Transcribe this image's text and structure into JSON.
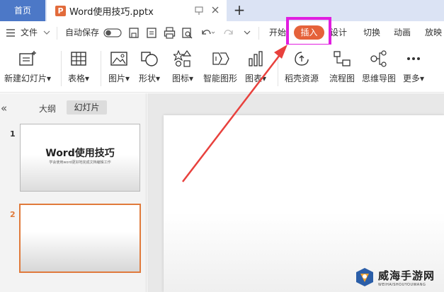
{
  "titlebar": {
    "home_tab": "首页",
    "doc_logo": "P",
    "doc_title": "Word使用技巧.pptx",
    "add_tab": "+"
  },
  "menubar": {
    "file": "文件",
    "autosave": "自动保存",
    "items": [
      "开始",
      "插入",
      "设计",
      "切换",
      "动画",
      "放映"
    ]
  },
  "ribbon": {
    "buttons": [
      {
        "label": "新建幻灯片",
        "icon": "new-slide-icon",
        "dropdown": true
      },
      {
        "label": "表格",
        "icon": "table-icon",
        "dropdown": true
      },
      {
        "label": "图片",
        "icon": "picture-icon",
        "dropdown": true
      },
      {
        "label": "形状",
        "icon": "shape-icon",
        "dropdown": true
      },
      {
        "label": "图标",
        "icon": "icons-icon",
        "dropdown": true
      },
      {
        "label": "智能图形",
        "icon": "smartart-icon",
        "dropdown": false
      },
      {
        "label": "图表",
        "icon": "chart-icon",
        "dropdown": true
      },
      {
        "label": "稻壳资源",
        "icon": "docer-resource-icon",
        "dropdown": false
      },
      {
        "label": "流程图",
        "icon": "flowchart-icon",
        "dropdown": false
      },
      {
        "label": "思维导图",
        "icon": "mindmap-icon",
        "dropdown": false
      },
      {
        "label": "更多",
        "icon": "more-icon",
        "dropdown": true
      }
    ]
  },
  "left_panel": {
    "collapse": "«",
    "tabs": [
      "大纲",
      "幻灯片"
    ],
    "slides": [
      {
        "number": "1",
        "title": "Word使用技巧",
        "subtitle": "学会使用word更好地完成文档编辑工作"
      },
      {
        "number": "2",
        "title": "",
        "subtitle": ""
      }
    ]
  },
  "watermark": {
    "name": "威海手游网",
    "url": "WEIHAISHOUYOUWANG"
  },
  "colors": {
    "accent": "#e5623a",
    "highlight": "#e11ee0",
    "arrow": "#e8413d",
    "home_tab": "#4c78c7",
    "selected_slide": "#e07a3b"
  }
}
